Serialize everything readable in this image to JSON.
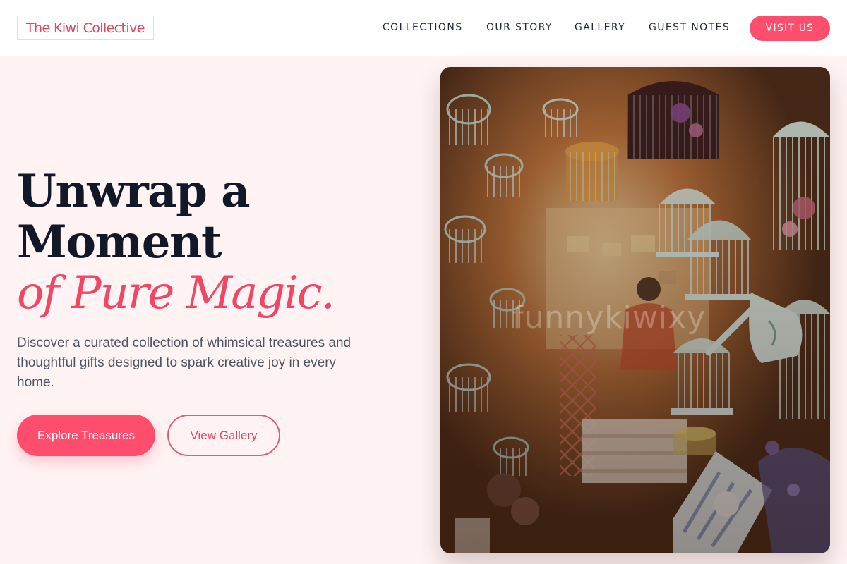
{
  "brand": {
    "name": "The Kiwi Collective"
  },
  "nav": {
    "items": [
      {
        "label": "COLLECTIONS"
      },
      {
        "label": "OUR STORY"
      },
      {
        "label": "GALLERY"
      },
      {
        "label": "GUEST NOTES"
      }
    ],
    "cta": "VISIT US"
  },
  "hero": {
    "headline_line1": "Unwrap a",
    "headline_line2": "Moment",
    "headline_accent": "of Pure Magic.",
    "description": "Discover a curated collection of whimsical treasures and thoughtful gifts designed to spark creative joy in every home.",
    "primary_button": "Explore Treasures",
    "secondary_button": "View Gallery",
    "image": {
      "watermark": "funnykiwixy"
    }
  },
  "colors": {
    "accent": "#ff4d6d",
    "accent_text": "#e0475e",
    "headline": "#111827",
    "hero_background": "#fff3f3"
  }
}
